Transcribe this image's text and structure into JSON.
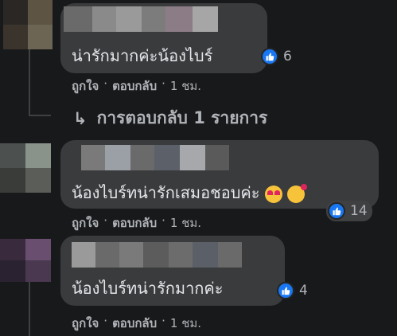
{
  "comments": [
    {
      "text": "น่ารักมากค่ะน้องไบร์",
      "reaction_count": "6",
      "actions": {
        "like": "ถูกใจ",
        "reply": "ตอบกลับ",
        "time": "1 ชม."
      }
    },
    {
      "text": "น้องไบร์ทน่ารักเสมอชอบค่ะ",
      "reaction_count": "14",
      "actions": {
        "like": "ถูกใจ",
        "reply": "ตอบกลับ",
        "time": "1 ชม."
      }
    },
    {
      "text": "น้องไบร์ทน่ารักมากค่ะ",
      "reaction_count": "4",
      "actions": {
        "like": "ถูกใจ",
        "reply": "ตอบกลับ",
        "time": "1 ชม."
      }
    }
  ],
  "replies_link": "การตอบกลับ 1 รายการ",
  "separator": "·",
  "colors": {
    "background": "#18191a",
    "bubble": "#3a3b3c",
    "accent": "#1877f2"
  }
}
